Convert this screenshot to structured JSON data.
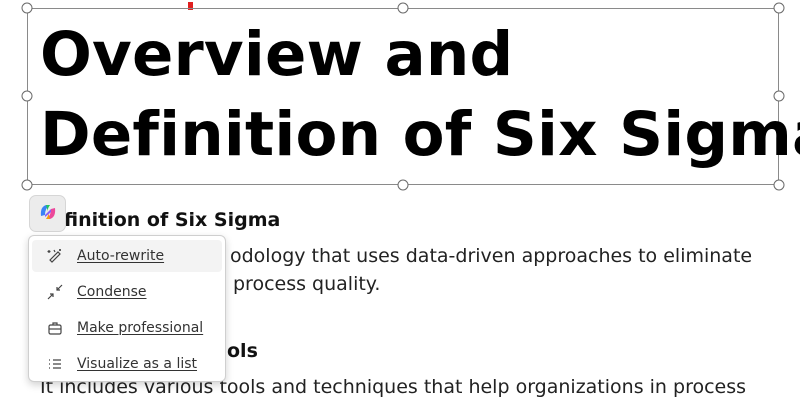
{
  "title": {
    "line1": "Overview and",
    "line2": "Definition of Six Sigma"
  },
  "content": {
    "section1_heading": "finition of Six Sigma",
    "para1_line1": "odology that uses data-driven approaches to eliminate",
    "para1_line2": "process quality.",
    "section2_heading": "ols",
    "para2_line1": "It includes various tools and techniques that help organizations in process"
  },
  "copilot": {
    "button_icon": "copilot-icon"
  },
  "menu": {
    "items": [
      {
        "label": "Auto-rewrite",
        "icon": "sparkle-pen-icon"
      },
      {
        "label": "Condense",
        "icon": "condense-arrows-icon"
      },
      {
        "label": "Make professional",
        "icon": "briefcase-icon"
      },
      {
        "label": "Visualize as a list",
        "icon": "list-icon"
      }
    ]
  },
  "colors": {
    "selection_border": "#8a8a8a",
    "menu_hover": "#f3f3f3",
    "cursor_mark": "#e02020"
  }
}
